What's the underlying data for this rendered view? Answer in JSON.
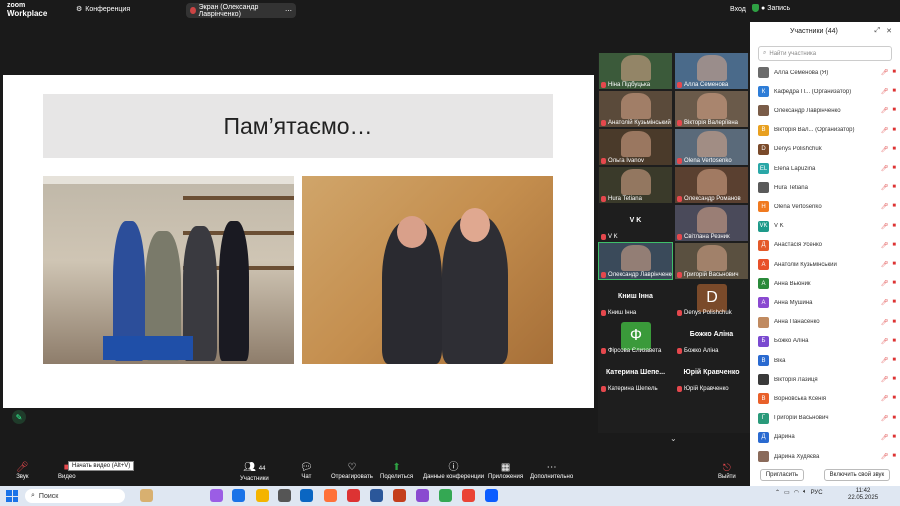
{
  "topbar": {
    "logo_line1": "zoom",
    "logo_line2": "Workplace",
    "conference_label": "Конференция",
    "screen_label": "Экран (Олександр Лаврінченко)",
    "login_label": "Вход",
    "record_label": "Запись"
  },
  "slide": {
    "title": "Пам’ятаємо…"
  },
  "tiles": [
    {
      "name": "Ніна Підбуцька",
      "type": "video"
    },
    {
      "name": "Алла Семенова",
      "type": "video"
    },
    {
      "name": "Анатолій Кузьмінський",
      "type": "video"
    },
    {
      "name": "Вікторія Валеріївна",
      "type": "video"
    },
    {
      "name": "Ольга Ivanov",
      "type": "video"
    },
    {
      "name": "Olena Vertosenko",
      "type": "video"
    },
    {
      "name": "Hura Tetiana",
      "type": "video"
    },
    {
      "name": "Олександр Романов",
      "type": "video"
    },
    {
      "name": "V K",
      "type": "text",
      "big": "V K"
    },
    {
      "name": "Світлана Резник",
      "type": "video"
    },
    {
      "name": "Олександр Лаврінченко",
      "type": "video"
    },
    {
      "name": "Григорій Васьнович",
      "type": "video"
    },
    {
      "name": "Книш Інна",
      "type": "text",
      "big": "Книш Інна"
    },
    {
      "name": "Denys Polishchuk",
      "type": "avatar",
      "letter": "D"
    },
    {
      "name": "Фірсова Єлизавета",
      "type": "avatar",
      "letter": "Ф"
    },
    {
      "name": "Божко Аліна",
      "type": "text",
      "big": "Божко Аліна"
    },
    {
      "name": "Катерина Шепель",
      "type": "text",
      "big": "Катерина Шепе..."
    },
    {
      "name": "Юрій Кравченко",
      "type": "text",
      "big": "Юрій Кравченко"
    }
  ],
  "bottombar": {
    "audio_label": "Звук",
    "video_label": "Видео",
    "tooltip": "Начать видео (Alt+V)",
    "participants_label": "Участники",
    "participants_count": "44",
    "react_label": "Отреагировать",
    "chat_label": "Чат",
    "share_label": "Поделиться",
    "data_label": "Данные конференции",
    "apps_label": "Приложения",
    "more_label": "Дополнительно",
    "leave_label": "Выйти"
  },
  "panel": {
    "title": "Участники (44)",
    "search_placeholder": "Найти участника",
    "participants": [
      {
        "name": "Алла Семенова (Я)",
        "initial": "",
        "color": "#6b6b6b"
      },
      {
        "name": "Кафедра П... (Организатор)",
        "initial": "К",
        "color": "#2e7dd7"
      },
      {
        "name": "Олександр Лаврінченко",
        "initial": "",
        "color": "#7a5c48"
      },
      {
        "name": "Вікторія Вал... (Организатор)",
        "initial": "В",
        "color": "#e8a020"
      },
      {
        "name": "Denys Polishchuk",
        "initial": "D",
        "color": "#7a4a2a"
      },
      {
        "name": "Elena Lapuzina",
        "initial": "EL",
        "color": "#2aa7a7"
      },
      {
        "name": "Hura Tetiana",
        "initial": "",
        "color": "#5a5a5a"
      },
      {
        "name": "Olena Vertosenko",
        "initial": "H",
        "color": "#f07a20"
      },
      {
        "name": "V K",
        "initial": "VK",
        "color": "#1e9a8a"
      },
      {
        "name": "Анастасія Усенко",
        "initial": "Д",
        "color": "#e45a2a"
      },
      {
        "name": "Анатолій Кузьмінський",
        "initial": "А",
        "color": "#e8502a"
      },
      {
        "name": "Анна Вьюник",
        "initial": "А",
        "color": "#2a8a3a"
      },
      {
        "name": "Анна Мушина",
        "initial": "А",
        "color": "#8a4ad0"
      },
      {
        "name": "Анна Панасенко",
        "initial": "",
        "color": "#c08a60"
      },
      {
        "name": "Божко Аліна",
        "initial": "Б",
        "color": "#7a4ad0"
      },
      {
        "name": "Віка",
        "initial": "В",
        "color": "#2a6ad0"
      },
      {
        "name": "Вікторія Лазиця",
        "initial": "",
        "color": "#3a3a3a"
      },
      {
        "name": "Ворновська Ксенія",
        "initial": "В",
        "color": "#e8602a"
      },
      {
        "name": "Григорій Васьнович",
        "initial": "Г",
        "color": "#2a9a7a"
      },
      {
        "name": "Дарина",
        "initial": "Д",
        "color": "#2a6ad0"
      },
      {
        "name": "Дарина Худяєва",
        "initial": "",
        "color": "#8a6a5a"
      }
    ],
    "invite_label": "Пригласить",
    "unmute_label": "Включить свой звук"
  },
  "taskbar": {
    "search_label": "Поиск",
    "lang": "РУС",
    "time": "11:42",
    "date": "22.05.2025"
  }
}
